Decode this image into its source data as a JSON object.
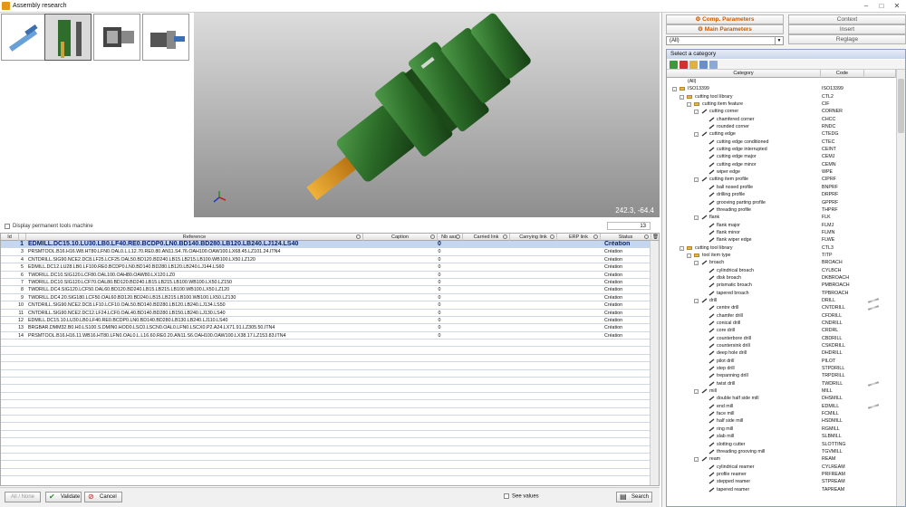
{
  "window": {
    "title": "Assembly research"
  },
  "viewer": {
    "coords": "242.3, -64.4"
  },
  "permanent": {
    "label": "Display permanent tools machine",
    "count": "13"
  },
  "grid": {
    "columns": [
      "Id",
      "Reference",
      "Caption",
      "Nb ass.",
      "Carried link",
      "Carrying link",
      "ERP link",
      "Status"
    ],
    "rows": [
      {
        "id": "1",
        "ref": "EDMILL.DC15.10.LU30.LB0.LF40.RE0.BCDP0.LN0.BD140.BD280.LB120.LB240.LJ124.LS40",
        "nb": "0",
        "status": "Création"
      },
      {
        "id": "3",
        "ref": "PRSMTOOL.B16.H16.W8.HT80.LFN0.OAL0.L.L12.70.RE0.80.AN11.S4.76.OAH100.OAW100.LX68.45.LZ101.24.ITN4",
        "nb": "0",
        "status": "Création"
      },
      {
        "id": "4",
        "ref": "CNTDRILL.SIG90.NCE2.DC8.LF25.LCF25.OAL50.BD120.BD240.LB15.LB215.LB100.WB100.LX50.LZ120",
        "nb": "0",
        "status": "Création"
      },
      {
        "id": "5",
        "ref": "EDMILL.DC12.LU28.LB0.LF100.RE0.BCDP0.LN0.BD140.BD280.LB120.LB240.LJ144.LS60",
        "nb": "0",
        "status": "Création"
      },
      {
        "id": "6",
        "ref": "TWDRILL.DC10.SIG120.LCF80.OAL100.OAH80.OAW80.LX120.LZ0",
        "nb": "0",
        "status": "Création"
      },
      {
        "id": "7",
        "ref": "TWDRILL.DC10.SIG120.LCF70.OAL80.BD120.BD240.LB15.LB215.LB100.WB100.LX50.LZ150",
        "nb": "0",
        "status": "Création"
      },
      {
        "id": "8",
        "ref": "TWDRILL.DC4.SIG120.LCF50.OAL60.BD120.BD240.LB15.LB215.LB100.WB100.LX50.LZ120",
        "nb": "0",
        "status": "Création"
      },
      {
        "id": "9",
        "ref": "TWDRILL.DC4.20.SIG180.LCF50.OAL60.BD120.BD240.LB15.LB215.LB100.WB100.LX50.LZ130",
        "nb": "0",
        "status": "Création"
      },
      {
        "id": "10",
        "ref": "CNTDRILL.SIG90.NCE2.DC8.LF10.LCF10.OAL50.BD140.BD280.LB120.LB240.LJ134.LS50",
        "nb": "0",
        "status": "Création"
      },
      {
        "id": "11",
        "ref": "CNTDRILL.SIG90.NCE2.DC12.LF24.LCF0.OAL40.BD140.BD280.LB150.LB240.LJ130.LS40",
        "nb": "0",
        "status": "Création"
      },
      {
        "id": "12",
        "ref": "EDMILL.DC15.10.LU30.LB0.LF40.RE0.BCDP0.LN0.BD140.BD280.LB130.LB240.LJ110.LS40",
        "nb": "0",
        "status": "Création"
      },
      {
        "id": "13",
        "ref": "BRGBAR.DMM32.B0.H0.LS100.S.DMIN0.HOD0.LSC0.LSCN0.OAL0.LFN0.LSCX0.P2.A24.LX71.91.LZ305.50.ITN4",
        "nb": "0",
        "status": "Création"
      },
      {
        "id": "14",
        "ref": "PRSMTOOL.B16.H16.11.WB16.HT80.LFN0.OAL0.L.L16.60.RE0.20.AN11.S6.OAH100.OAW100.LX38.17.LZ153.83.ITN4",
        "nb": "0",
        "status": "Création"
      }
    ]
  },
  "bottom": {
    "all_none": "All / None",
    "validate": "Validate",
    "cancel": "Cancel",
    "see_values": "See values",
    "search": "Search"
  },
  "right": {
    "tabs": {
      "comp": "Comp. Parameters",
      "main": "Main Parameters",
      "context": "Context",
      "insert": "Insert",
      "reglage": "Reglage"
    },
    "combo_value": "(All)",
    "category_title": "Select a category",
    "category_columns": [
      "Category",
      "Code"
    ],
    "tree": [
      {
        "d": 0,
        "t": "leaf",
        "name": "(All)",
        "code": ""
      },
      {
        "d": 0,
        "t": "folder",
        "name": "ISO13399",
        "code": "ISO13399"
      },
      {
        "d": 1,
        "t": "folder",
        "name": "cutting tool library",
        "code": "CTL2"
      },
      {
        "d": 2,
        "t": "folder",
        "name": "cutting item feature",
        "code": "CIF"
      },
      {
        "d": 3,
        "t": "node",
        "name": "cutting corner",
        "code": "CORNER"
      },
      {
        "d": 4,
        "t": "leaf",
        "name": "chamfered corner",
        "code": "CHCC"
      },
      {
        "d": 4,
        "t": "leaf",
        "name": "rounded corner",
        "code": "RNDC"
      },
      {
        "d": 3,
        "t": "node",
        "name": "cutting edge",
        "code": "CTEDG"
      },
      {
        "d": 4,
        "t": "leaf",
        "name": "cutting edge conditioned",
        "code": "CTEC"
      },
      {
        "d": 4,
        "t": "leaf",
        "name": "cutting edge interrupted",
        "code": "CEINT"
      },
      {
        "d": 4,
        "t": "leaf",
        "name": "cutting edge major",
        "code": "CEMJ"
      },
      {
        "d": 4,
        "t": "leaf",
        "name": "cutting edge minor",
        "code": "CEMN"
      },
      {
        "d": 4,
        "t": "leaf",
        "name": "wiper edge",
        "code": "WPE"
      },
      {
        "d": 3,
        "t": "node",
        "name": "cutting item profile",
        "code": "CIPRF"
      },
      {
        "d": 4,
        "t": "leaf",
        "name": "ball nosed profile",
        "code": "BNPRF"
      },
      {
        "d": 4,
        "t": "leaf",
        "name": "drilling profile",
        "code": "DRPRF"
      },
      {
        "d": 4,
        "t": "leaf",
        "name": "grooving parting profile",
        "code": "GPPRF"
      },
      {
        "d": 4,
        "t": "leaf",
        "name": "threading profile",
        "code": "THPRF"
      },
      {
        "d": 3,
        "t": "node",
        "name": "flank",
        "code": "FLK"
      },
      {
        "d": 4,
        "t": "leaf",
        "name": "flank major",
        "code": "FLMJ"
      },
      {
        "d": 4,
        "t": "leaf",
        "name": "flank minor",
        "code": "FLMN"
      },
      {
        "d": 4,
        "t": "leaf",
        "name": "flank wiper edge",
        "code": "FLWE"
      },
      {
        "d": 1,
        "t": "folder",
        "name": "cutting tool library",
        "code": "CTL3"
      },
      {
        "d": 2,
        "t": "folder",
        "name": "tool item type",
        "code": "TITP"
      },
      {
        "d": 3,
        "t": "node",
        "name": "broach",
        "code": "BROACH"
      },
      {
        "d": 4,
        "t": "leaf",
        "name": "cylindrical broach",
        "code": "CYLBCH"
      },
      {
        "d": 4,
        "t": "leaf",
        "name": "disk broach",
        "code": "DKBROACH"
      },
      {
        "d": 4,
        "t": "leaf",
        "name": "prismatic broach",
        "code": "PMBROACH"
      },
      {
        "d": 4,
        "t": "leaf",
        "name": "tapered broach",
        "code": "TPBROACH"
      },
      {
        "d": 3,
        "t": "node",
        "name": "drill",
        "code": "DRILL",
        "tool": true
      },
      {
        "d": 4,
        "t": "leaf",
        "name": "centre drill",
        "code": "CNTDRILL",
        "tool": true
      },
      {
        "d": 4,
        "t": "leaf",
        "name": "chamfer drill",
        "code": "CFDRILL"
      },
      {
        "d": 4,
        "t": "leaf",
        "name": "conical drill",
        "code": "CNDRILL"
      },
      {
        "d": 4,
        "t": "leaf",
        "name": "core drill",
        "code": "CRDRL"
      },
      {
        "d": 4,
        "t": "leaf",
        "name": "counterbore drill",
        "code": "CBDRILL"
      },
      {
        "d": 4,
        "t": "leaf",
        "name": "countersink drill",
        "code": "CSKDRILL"
      },
      {
        "d": 4,
        "t": "leaf",
        "name": "deep hole drill",
        "code": "DHDRILL"
      },
      {
        "d": 4,
        "t": "leaf",
        "name": "pilot drill",
        "code": "PILOT"
      },
      {
        "d": 4,
        "t": "leaf",
        "name": "step drill",
        "code": "STPDRILL"
      },
      {
        "d": 4,
        "t": "leaf",
        "name": "trepanning drill",
        "code": "TRPDRILL"
      },
      {
        "d": 4,
        "t": "leaf",
        "name": "twist drill",
        "code": "TWDRILL",
        "tool": true
      },
      {
        "d": 3,
        "t": "node",
        "name": "mill",
        "code": "MILL"
      },
      {
        "d": 4,
        "t": "leaf",
        "name": "double half side mill",
        "code": "DHSMILL"
      },
      {
        "d": 4,
        "t": "leaf",
        "name": "end mill",
        "code": "EDMILL",
        "tool": true
      },
      {
        "d": 4,
        "t": "leaf",
        "name": "face mill",
        "code": "FCMILL"
      },
      {
        "d": 4,
        "t": "leaf",
        "name": "half side mill",
        "code": "HSDMILL"
      },
      {
        "d": 4,
        "t": "leaf",
        "name": "ring mill",
        "code": "RGMILL"
      },
      {
        "d": 4,
        "t": "leaf",
        "name": "slab mill",
        "code": "SLBMILL"
      },
      {
        "d": 4,
        "t": "leaf",
        "name": "slotting cutter",
        "code": "SLOTTING"
      },
      {
        "d": 4,
        "t": "leaf",
        "name": "threading grooving mill",
        "code": "TGVMILL"
      },
      {
        "d": 3,
        "t": "node",
        "name": "ream",
        "code": "REAM"
      },
      {
        "d": 4,
        "t": "leaf",
        "name": "cylindrical reamer",
        "code": "CYLREAM"
      },
      {
        "d": 4,
        "t": "leaf",
        "name": "profile reamer",
        "code": "PRFREAM"
      },
      {
        "d": 4,
        "t": "leaf",
        "name": "stepped reamer",
        "code": "STPREAM"
      },
      {
        "d": 4,
        "t": "leaf",
        "name": "tapered reamer",
        "code": "TAPREAM"
      }
    ]
  }
}
